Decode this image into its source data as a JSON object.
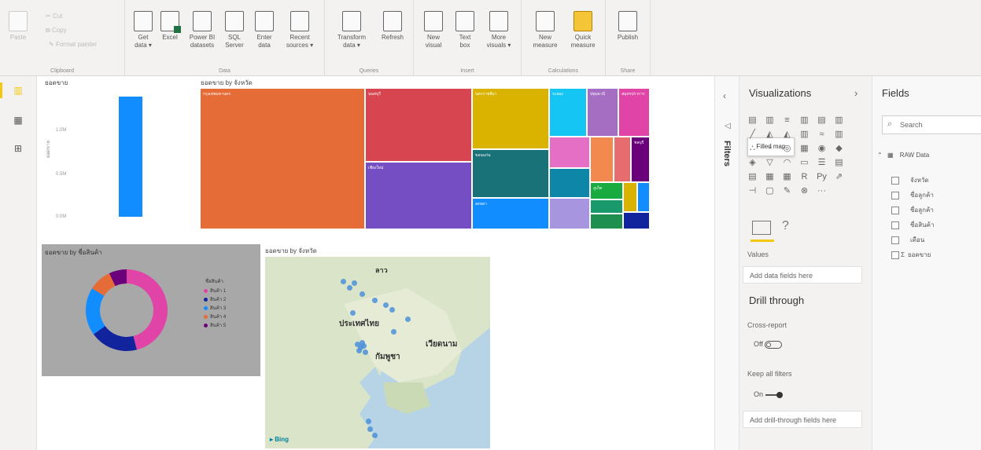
{
  "ribbon": {
    "clipboard": {
      "label": "Clipboard",
      "paste": "Paste",
      "cut": "Cut",
      "copy": "Copy",
      "format_painter": "Format painter"
    },
    "data": {
      "label": "Data",
      "buttons": [
        {
          "l1": "Get",
          "l2": "data"
        },
        {
          "l1": "Excel",
          "l2": ""
        },
        {
          "l1": "Power BI",
          "l2": "datasets"
        },
        {
          "l1": "SQL",
          "l2": "Server"
        },
        {
          "l1": "Enter",
          "l2": "data"
        },
        {
          "l1": "Recent",
          "l2": "sources"
        }
      ]
    },
    "queries": {
      "label": "Queries",
      "buttons": [
        {
          "l1": "Transform",
          "l2": "data"
        },
        {
          "l1": "Refresh",
          "l2": ""
        }
      ]
    },
    "insert": {
      "label": "Insert",
      "buttons": [
        {
          "l1": "New",
          "l2": "visual"
        },
        {
          "l1": "Text",
          "l2": "box"
        },
        {
          "l1": "More",
          "l2": "visuals"
        }
      ]
    },
    "calculations": {
      "label": "Calculations",
      "buttons": [
        {
          "l1": "New",
          "l2": "measure"
        },
        {
          "l1": "Quick",
          "l2": "measure"
        }
      ]
    },
    "share": {
      "label": "Share",
      "buttons": [
        {
          "l1": "Publish",
          "l2": ""
        }
      ]
    }
  },
  "canvas": {
    "card_visual": {
      "title": "ยอดขาย",
      "y_ticks": [
        "1.0M",
        "0.5M",
        "0.0M"
      ],
      "y_axis_label": "ยอดขาย",
      "bar_color": "#118dff"
    },
    "treemap": {
      "title": "ยอดขาย by จังหวัด",
      "tiles": [
        {
          "label": "กรุงเทพมหานคร",
          "color": "#e66c37"
        },
        {
          "label": "นนทบุรี",
          "color": "#d64550"
        },
        {
          "label": "ชลบุรี",
          "color": "#6b007b"
        },
        {
          "label": "สมุทรปราการ",
          "color": "#12239e"
        },
        {
          "label": "ปทุมธานี",
          "color": "#e044a7"
        },
        {
          "label": "เชียงใหม่",
          "color": "#744ec2"
        },
        {
          "label": "นครราชสีมา",
          "color": "#d9b300"
        },
        {
          "label": "ขอนแก่น",
          "color": "#197278"
        },
        {
          "label": "สงขลา",
          "color": "#118dff"
        },
        {
          "label": "ภูเก็ต",
          "color": "#1aab40"
        },
        {
          "label": "ระยอง",
          "color": "#15c6f4"
        }
      ]
    },
    "donut": {
      "title": "ยอดขาย by ชื่อสินค้า",
      "legend_title": "ชื่อสินค้า",
      "segments": [
        {
          "name": "สินค้า 1",
          "value": 46,
          "color": "#e044a7"
        },
        {
          "name": "สินค้า 2",
          "value": 19,
          "color": "#12239e"
        },
        {
          "name": "สินค้า 3",
          "value": 19,
          "color": "#118dff"
        },
        {
          "name": "สินค้า 4",
          "value": 9,
          "color": "#e66c37"
        },
        {
          "name": "สินค้า 5",
          "value": 7,
          "color": "#6b007b"
        }
      ]
    },
    "map": {
      "title": "ยอดขาย by จังหวัด",
      "labels": {
        "laos": "ลาว",
        "thailand": "ประเทศไทย",
        "cambodia": "กัมพูชา",
        "vietnam": "เวียดนาม"
      },
      "bing_label": "Bing",
      "dot_color": "#4a90d9"
    }
  },
  "filters_pane": {
    "label": "Filters",
    "collapse_glyph": "‹"
  },
  "viz_pane": {
    "title": "Visualizations",
    "expand_glyph": "›",
    "tooltip": "Filled map",
    "icons": [
      "stacked-bar-icon",
      "stacked-column-icon",
      "clustered-bar-icon",
      "clustered-column-icon",
      "100pct-bar-icon",
      "100pct-column-icon",
      "line-chart-icon",
      "area-chart-icon",
      "stacked-area-icon",
      "line-column-icon",
      "ribbon-chart-icon",
      "waterfall-icon",
      "scatter-icon",
      "pie-chart-icon",
      "donut-chart-icon",
      "treemap-icon",
      "map-icon",
      "filled-map-icon",
      "shape-map-icon",
      "funnel-icon",
      "gauge-icon",
      "card-icon",
      "multirow-card-icon",
      "kpi-icon",
      "slicer-icon",
      "table-icon",
      "matrix-icon",
      "r-visual-icon",
      "python-visual-icon",
      "key-influencers-icon",
      "decomposition-tree-icon",
      "qna-icon",
      "smart-narrative-icon",
      "paginated-icon",
      "more-visuals-icon"
    ],
    "icon_glyphs": [
      "▤",
      "▥",
      "≡",
      "▥",
      "▤",
      "▥",
      "╱",
      "◭",
      "◭",
      "▥",
      "≈",
      "▥",
      "∴",
      "◔",
      "◎",
      "▦",
      "◉",
      "◆",
      "◈",
      "▽",
      "◠",
      "▭",
      "☰",
      "▤",
      "▤",
      "▦",
      "▦",
      "R",
      "Py",
      "⇗",
      "⊣",
      "▢",
      "✎",
      "⊗",
      "···"
    ],
    "fields_well": {
      "section_label": "Values",
      "placeholder": "Add data fields here"
    },
    "drill_through": {
      "title": "Drill through",
      "cross_report_label": "Cross-report",
      "cross_report_state": "Off",
      "keep_filters_label": "Keep all filters",
      "keep_filters_state": "On",
      "drop_placeholder": "Add drill-through fields here"
    }
  },
  "fields_pane": {
    "title": "Fields",
    "search_placeholder": "Search",
    "table_name": "RAW Data",
    "fields": [
      {
        "name": "จังหวัด",
        "sigma": false
      },
      {
        "name": "ชื่อลูกค้า",
        "sigma": false
      },
      {
        "name": "ชื่อลูกค้า",
        "sigma": false
      },
      {
        "name": "ชื่อสินค้า",
        "sigma": false
      },
      {
        "name": "เดือน",
        "sigma": false
      },
      {
        "name": "ยอดขาย",
        "sigma": true
      }
    ]
  }
}
